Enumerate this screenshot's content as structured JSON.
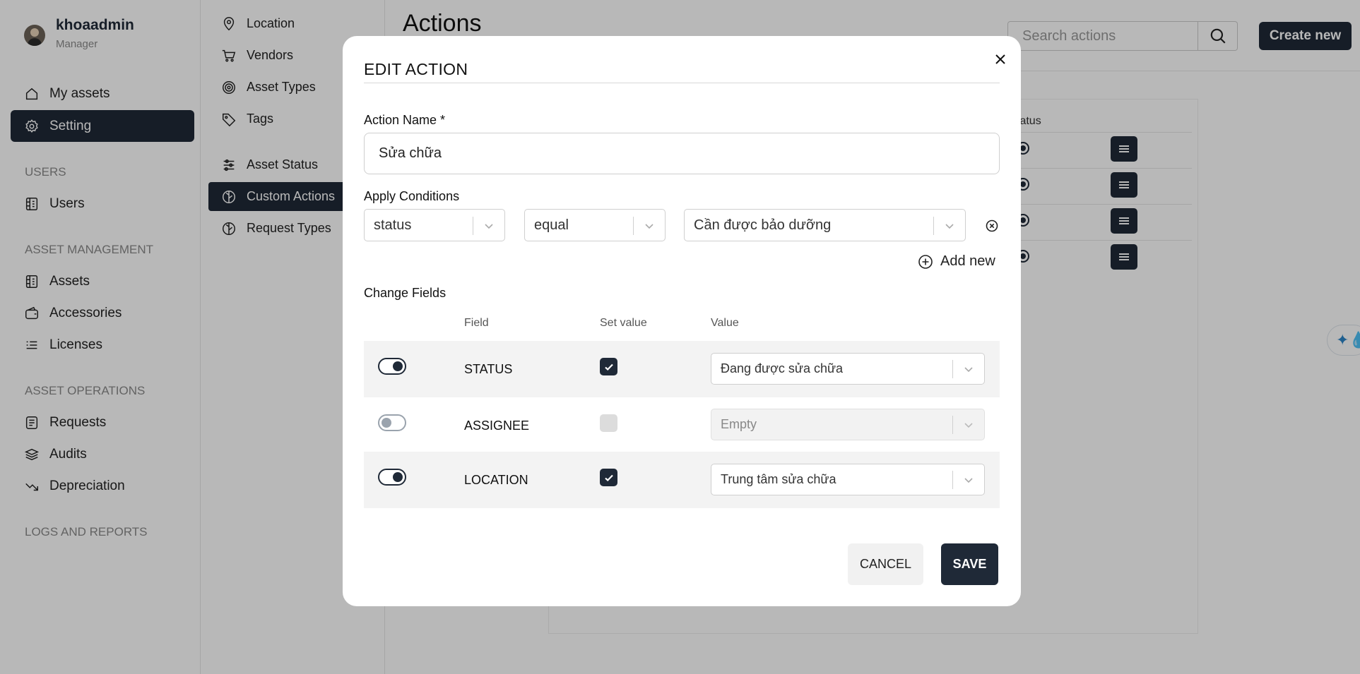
{
  "user": {
    "name": "khoaadmin",
    "role": "Manager"
  },
  "sidebar": {
    "top_items": [
      {
        "label": "My assets",
        "icon": "house-icon"
      },
      {
        "label": "Setting",
        "icon": "gear-icon",
        "active": true
      }
    ],
    "sections": [
      {
        "title": "USERS",
        "items": [
          {
            "label": "Users",
            "icon": "building-icon"
          }
        ]
      },
      {
        "title": "ASSET MANAGEMENT",
        "items": [
          {
            "label": "Assets",
            "icon": "building-icon"
          },
          {
            "label": "Accessories",
            "icon": "wallet-icon"
          },
          {
            "label": "Licenses",
            "icon": "list-icon"
          }
        ]
      },
      {
        "title": "ASSET OPERATIONS",
        "items": [
          {
            "label": "Requests",
            "icon": "document-icon"
          },
          {
            "label": "Audits",
            "icon": "layers-icon"
          },
          {
            "label": "Depreciation",
            "icon": "trend-down-icon"
          }
        ]
      },
      {
        "title": "LOGS AND REPORTS",
        "items": []
      }
    ]
  },
  "subnav": {
    "items": [
      {
        "label": "Location",
        "icon": "map-pin-icon"
      },
      {
        "label": "Vendors",
        "icon": "cart-icon"
      },
      {
        "label": "Asset Types",
        "icon": "target-icon"
      },
      {
        "label": "Tags",
        "icon": "tag-icon"
      },
      {
        "label": "Asset Status",
        "icon": "sliders-icon"
      },
      {
        "label": "Custom Actions",
        "icon": "leaf-icon",
        "active": true
      },
      {
        "label": "Request Types",
        "icon": "leaf-icon"
      }
    ]
  },
  "main": {
    "title": "Actions",
    "search_placeholder": "Search actions",
    "create_label": "Create new",
    "table": {
      "status_header": "tatus"
    }
  },
  "modal": {
    "title": "EDIT ACTION",
    "action_name_label": "Action Name *",
    "action_name_value": "Sửa chữa",
    "apply_conditions_label": "Apply Conditions",
    "conditions": [
      {
        "field": "status",
        "operator": "equal",
        "value": "Cần được bảo dưỡng"
      }
    ],
    "add_new_label": "Add new",
    "change_fields_label": "Change Fields",
    "columns": {
      "field": "Field",
      "set_value": "Set value",
      "value": "Value"
    },
    "fields": [
      {
        "name": "STATUS",
        "enabled": true,
        "set_value": true,
        "value": "Đang được sửa chữa"
      },
      {
        "name": "ASSIGNEE",
        "enabled": false,
        "set_value": false,
        "value": "Empty"
      },
      {
        "name": "LOCATION",
        "enabled": true,
        "set_value": true,
        "value": "Trung tâm sửa chữa"
      }
    ],
    "cancel_label": "CANCEL",
    "save_label": "SAVE"
  },
  "colors": {
    "primary_dark": "#1f2937",
    "overlay": "rgba(0,0,0,0.28)",
    "accent_blue": "#2b84c6"
  }
}
